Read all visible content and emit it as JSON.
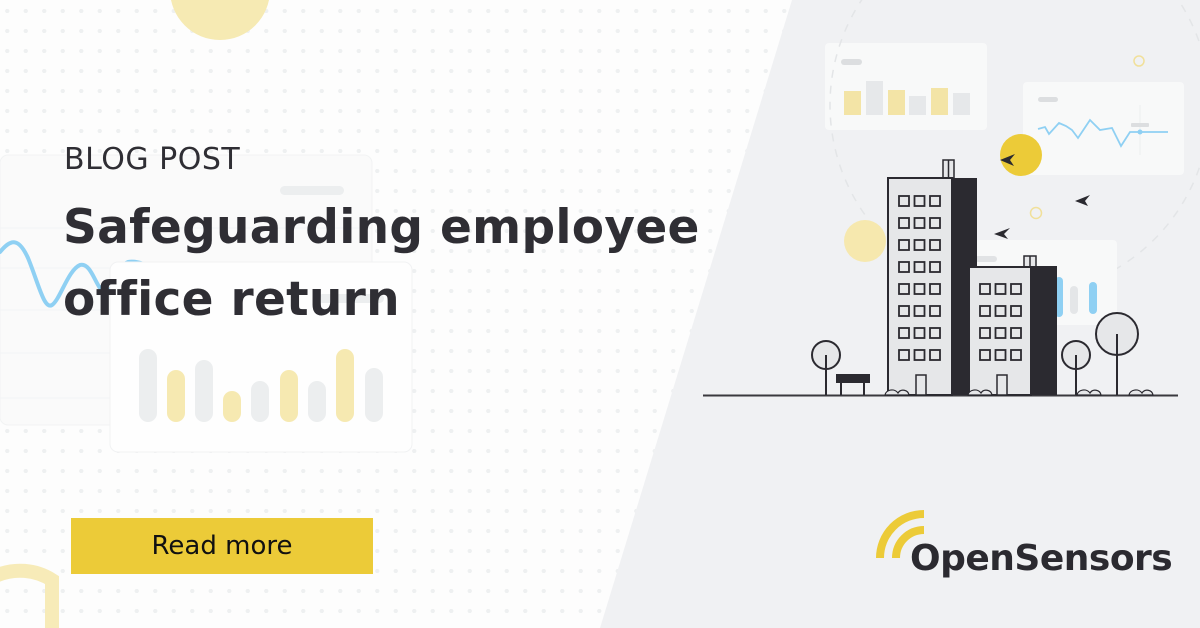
{
  "post": {
    "kicker": "BLOG POST",
    "title_line1": "Safeguarding employee",
    "title_line2": "office return"
  },
  "cta": {
    "label": "Read more"
  },
  "brand": {
    "name": "OpenSensors"
  },
  "colors": {
    "accent_yellow": "#eccb38",
    "pale_yellow": "#f6e8ae",
    "text_dark": "#2f2e34",
    "line_blue": "#8fd0f3",
    "panel_gray": "#f0f1f3"
  },
  "icons": {
    "logo_mark": "signal-arcs-icon",
    "illustration": "city-buildings-illustration",
    "birds": "bird-icon"
  }
}
